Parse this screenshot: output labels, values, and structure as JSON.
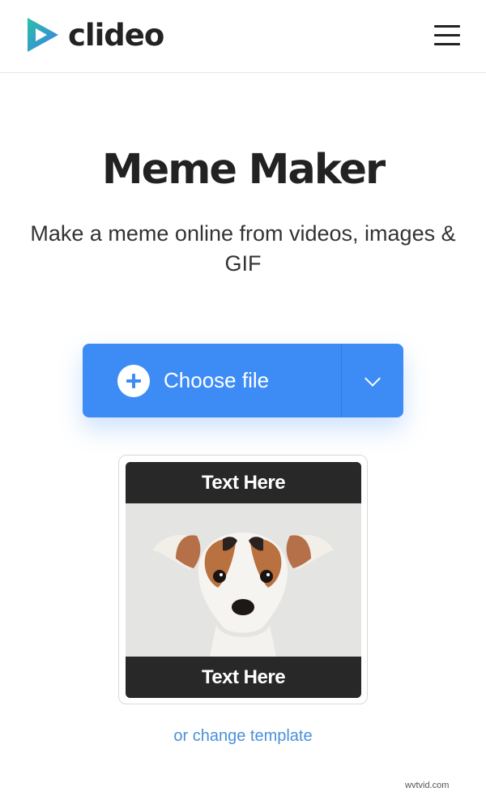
{
  "header": {
    "logo_text": "clideo",
    "brand_colors": {
      "logo_teal": "#2ac0a6",
      "logo_blue": "#3d7ee8"
    },
    "menu_icon": "hamburger-menu-icon"
  },
  "main": {
    "title": "Meme Maker",
    "subtitle": "Make a meme online from videos, images & GIF"
  },
  "upload": {
    "choose_label": "Choose file",
    "plus_icon": "plus-circle-icon",
    "dropdown_icon": "chevron-down-icon",
    "accent_color": "#3d8cf6"
  },
  "template": {
    "top_text": "Text Here",
    "bottom_text": "Text Here",
    "image_subject": "dog-photo"
  },
  "change_template_link": "or change template",
  "watermark": "wvtvid.com"
}
